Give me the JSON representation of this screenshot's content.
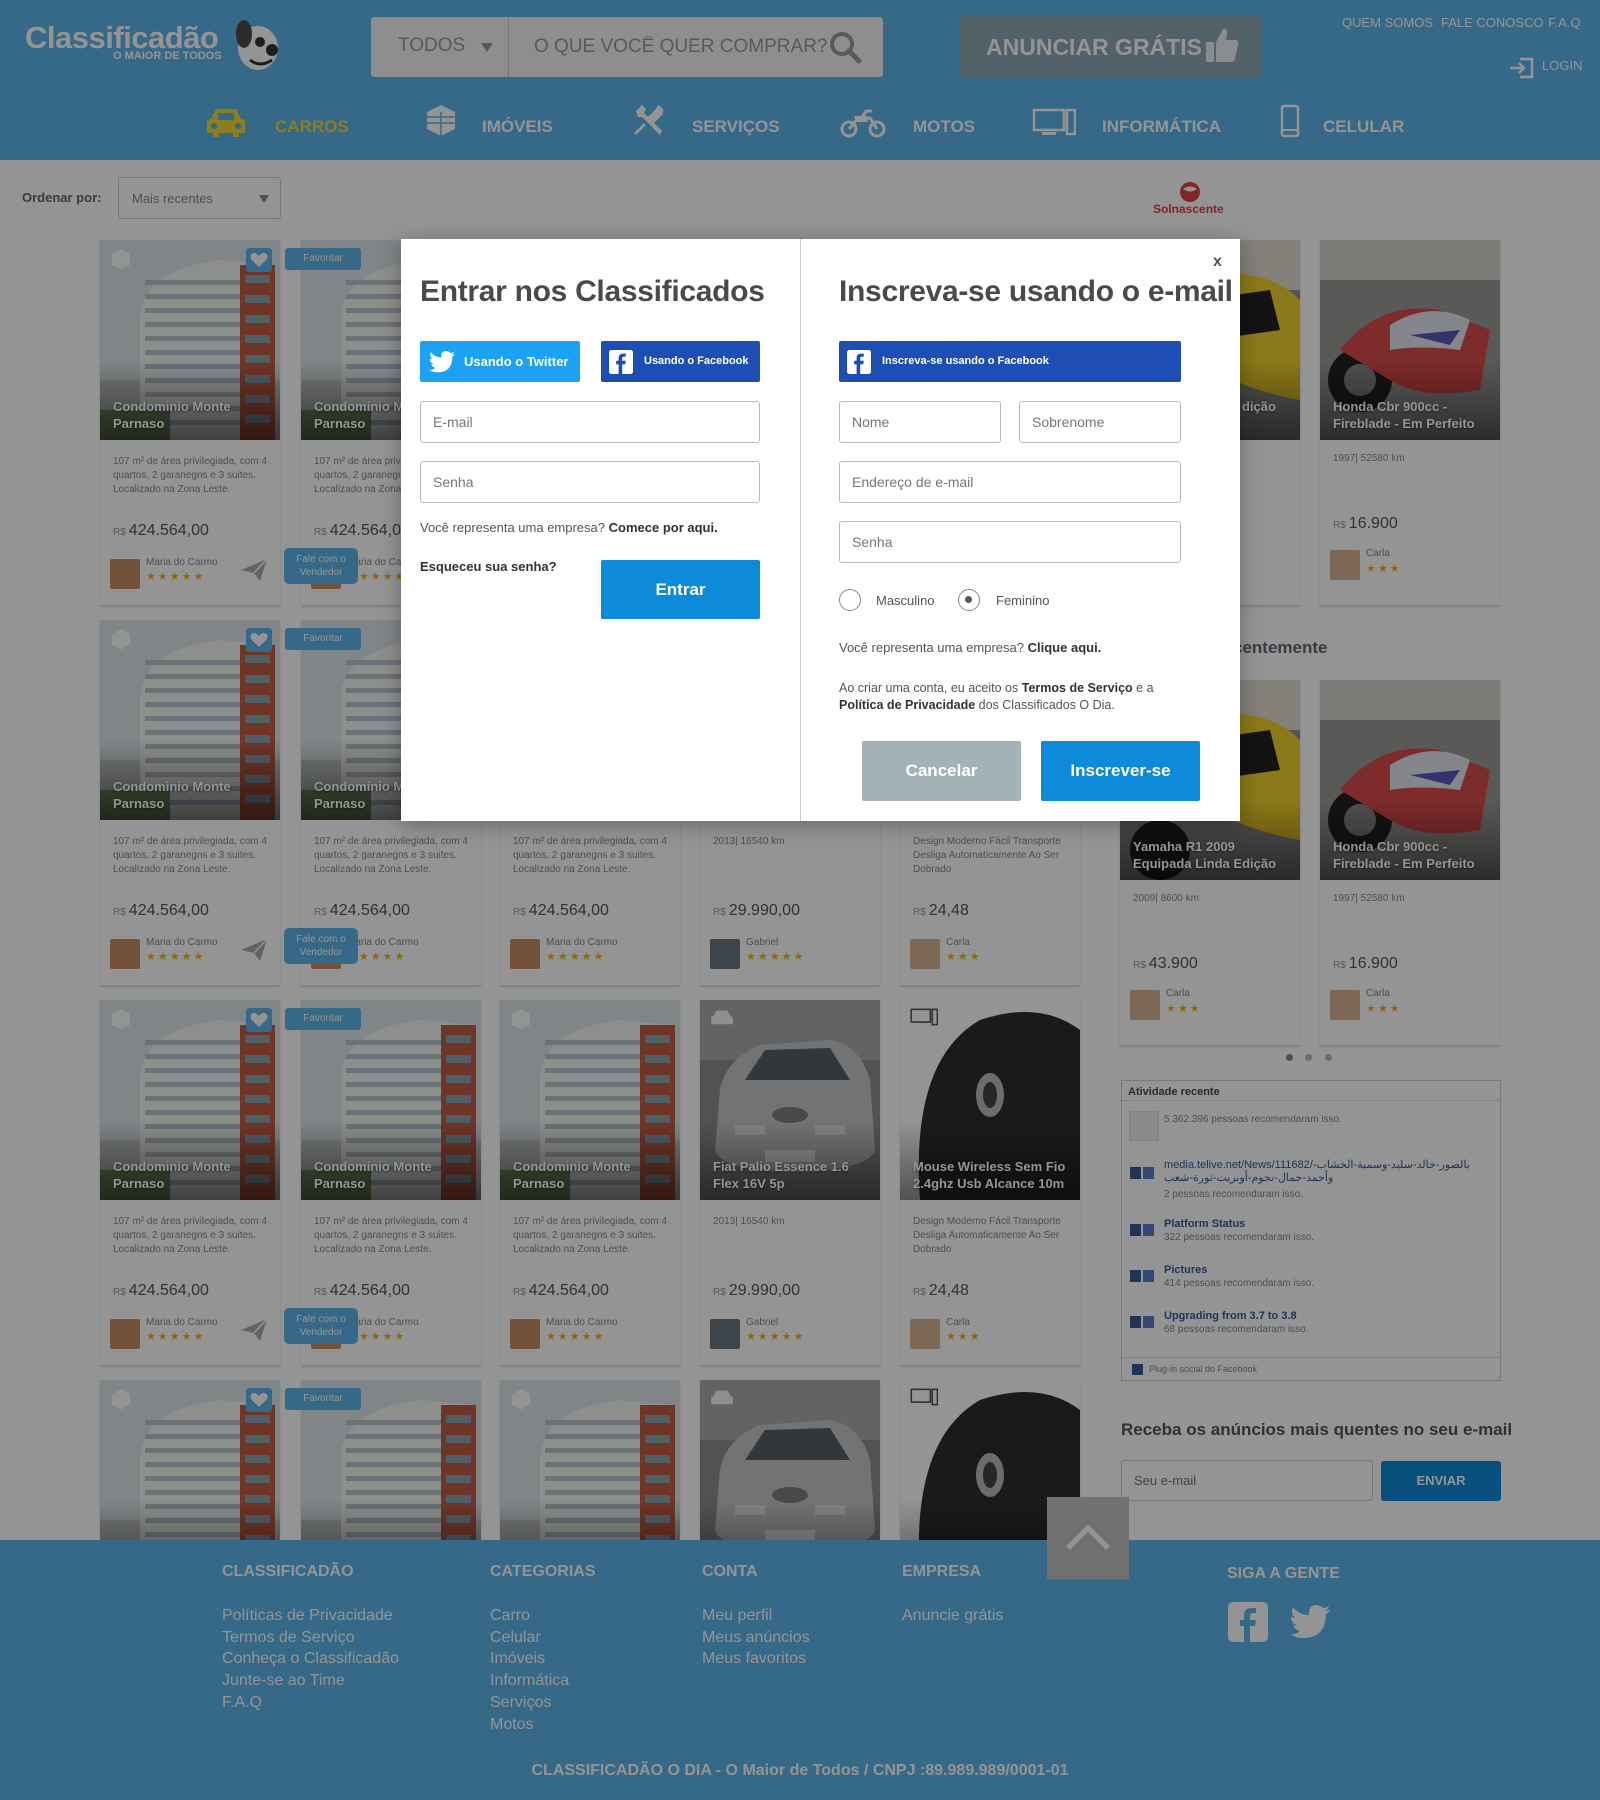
{
  "header": {
    "logo_main": "Classificadão",
    "logo_sub": "O MAIOR DE TODOS",
    "search": {
      "category": "TODOS",
      "placeholder": "O QUE VOCÊ QUER COMPRAR?"
    },
    "advertise_label": "ANUNCIAR GRÁTIS",
    "top_links": [
      "QUEM SOMOS",
      "FALE CONOSCO",
      "F.A.Q"
    ],
    "login_label": "LOGIN",
    "nav": [
      {
        "label": "CARROS",
        "icon": "car-icon"
      },
      {
        "label": "IMÓVEIS",
        "icon": "building-icon"
      },
      {
        "label": "SERVIÇOS",
        "icon": "tools-icon"
      },
      {
        "label": "MOTOS",
        "icon": "motorcycle-icon"
      },
      {
        "label": "INFORMÁTICA",
        "icon": "computer-icon"
      },
      {
        "label": "CELULAR",
        "icon": "cellphone-icon"
      }
    ]
  },
  "sort": {
    "label": "Ordenar por:",
    "value": "Mais recentes"
  },
  "sponsor": "Solnascente",
  "listing": {
    "favorite_label": "Favoritar",
    "contact_label": "Fale com o Vendedor",
    "currency": "R$",
    "building": {
      "title": "Condominio Monte Parnaso",
      "desc": "107 m² de área privilegiada, com 4 quartos, 2 garanegns e 3 suites. Localizado na Zona Leste.",
      "price": "424.564,00",
      "seller": "Maria do Carmo"
    },
    "car": {
      "title": "Fiat Palio Essence 1.6 Flex 16V 5p",
      "desc": "2013| 16540 km",
      "price": "29.990,00",
      "seller": "Gabriel"
    },
    "mouse": {
      "title": "Mouse Wireless Sem Fio 2.4ghz Usb Alcance 10m",
      "desc": "Design Moderno Fácil Transporte Desliga Automaticamente Ao Ser Dobrado",
      "price": "24,48",
      "seller": "Carla"
    }
  },
  "sidebar": {
    "top_cards": [
      {
        "title_fragment": "dição"
      },
      {
        "title": "Honda Cbr 900cc - Fireblade - Em Perfeito",
        "desc": "1997| 52580 km",
        "price": "16.900",
        "seller": "Carla"
      }
    ],
    "recent_title_fragment": "centemente",
    "recent_cards": [
      {
        "title": "Yamaha R1 2009 Equipada Linda Edição",
        "desc": "2009| 8600 km",
        "price": "43.900",
        "seller": "Carla"
      },
      {
        "title": "Honda Cbr 900cc - Fireblade - Em Perfeito",
        "desc": "1997| 52580 km",
        "price": "16.900",
        "seller": "Carla"
      }
    ],
    "activity": {
      "title": "Atividade recente",
      "items": [
        {
          "title": "",
          "sub": "5.362.396 pessoas recomendaram isso."
        },
        {
          "title": "media.telive.net/News/111682/بالصور-خالد-سليد-وسمية-الخشاب-وأحمد-جمال-نجوم-أوبريت-ثورة-شعب",
          "sub": "2 pessoas recomendaram isso."
        },
        {
          "title": "Platform Status",
          "sub": "322 pessoas recomendaram isso."
        },
        {
          "title": "Pictures",
          "sub": "414 pessoas recomendaram isso."
        },
        {
          "title": "Upgrading from 3.7 to 3.8",
          "sub": "68 pessoas recomendaram isso."
        }
      ],
      "plugin_label": "Plug-in social do Facebook"
    },
    "newsletter": {
      "title": "Receba os anúncios mais quentes no seu e-mail",
      "placeholder": "Seu e-mail",
      "button": "ENVIAR"
    }
  },
  "footer": {
    "cols": [
      {
        "title": "CLASSIFICADÃO",
        "links": [
          "Políticas de Privacidade",
          "Termos de Serviço",
          "Conheça o Classificadão",
          "Junte-se ao Time",
          "F.A.Q"
        ]
      },
      {
        "title": "CATEGORIAS",
        "links": [
          "Carro",
          "Celular",
          "Imóveis",
          "Informática",
          "Serviços",
          "Motos"
        ]
      },
      {
        "title": "CONTA",
        "links": [
          "Meu perfil",
          "Meus anúncios",
          "Meus favoritos"
        ]
      },
      {
        "title": "EMPRESA",
        "links": [
          "Anuncie grátis"
        ]
      }
    ],
    "social_title": "SIGA A GENTE",
    "copyright": "CLASSIFICADÃO O DIA - O Maior de Todos / CNPJ :89.989.989/0001-01"
  },
  "modal": {
    "close": "x",
    "login": {
      "title": "Entrar nos Classificados",
      "twitter": "Usando o Twitter",
      "facebook": "Usando o Facebook",
      "email_placeholder": "E-mail",
      "password_placeholder": "Senha",
      "company_text": "Você representa uma empresa?",
      "company_link": "Comece por aqui.",
      "forgot": "Esqueceu sua senha?",
      "submit": "Entrar"
    },
    "signup": {
      "title": "Inscreva-se usando o e-mail",
      "facebook": "Inscreva-se usando o Facebook",
      "first_name": "Nome",
      "last_name": "Sobrenome",
      "email": "Endereço de e-mail",
      "password": "Senha",
      "gender_male": "Masculino",
      "gender_female": "Feminino",
      "gender_selected": "Feminino",
      "company_text": "Você representa uma empresa?",
      "company_link": "Clique aqui.",
      "terms_1": "Ao criar uma conta, eu aceito os",
      "terms_link_1": "Termos de Serviço",
      "terms_2": "e a",
      "terms_link_2": "Política de Privacidade",
      "terms_3": "dos Classificados O Dia.",
      "cancel": "Cancelar",
      "submit": "Inscrever-se"
    }
  },
  "colors": {
    "primary": "#5cb6e8",
    "button": "#0d8ad8",
    "facebook": "#1e4db4",
    "twitter": "#1da1f2",
    "star": "#f2b51b",
    "nav_active": "#f0d93a"
  }
}
